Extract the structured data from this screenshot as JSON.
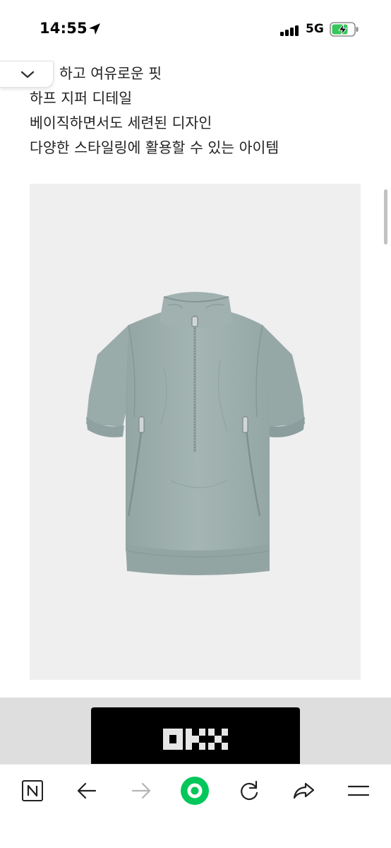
{
  "status_bar": {
    "time": "14:55",
    "network": "5G",
    "icons": [
      "location-arrow-icon",
      "signal-bars-icon",
      "battery-charging-icon"
    ]
  },
  "description": {
    "lines": [
      "넉넉하고 여유로운 핏",
      "하프 지퍼 디테일",
      "베이직하면서도 세련된 디자인",
      "다양한 스타일링에 활용할 수 있는 아이템"
    ],
    "visible_fragment": "하고 여유로운 핏"
  },
  "collapse_button": {
    "icon": "chevron-down-icon"
  },
  "product_image": {
    "subject": "half-zip short-sleeve anorak",
    "colors": {
      "garment": "#9fb0ae",
      "shadow": "#8a9b99",
      "background": "#efefef"
    }
  },
  "ad": {
    "brand_text": "OKX",
    "background": "#000000"
  },
  "toolbar": {
    "items": [
      {
        "name": "naver-home",
        "icon": "naver-n-icon"
      },
      {
        "name": "back",
        "icon": "arrow-left-icon"
      },
      {
        "name": "forward",
        "icon": "arrow-right-icon",
        "disabled": true
      },
      {
        "name": "green-dot",
        "icon": "green-dot-icon",
        "color": "#03c75a"
      },
      {
        "name": "reload",
        "icon": "reload-icon"
      },
      {
        "name": "share",
        "icon": "share-icon"
      },
      {
        "name": "menu",
        "icon": "hamburger-menu-icon"
      }
    ]
  }
}
